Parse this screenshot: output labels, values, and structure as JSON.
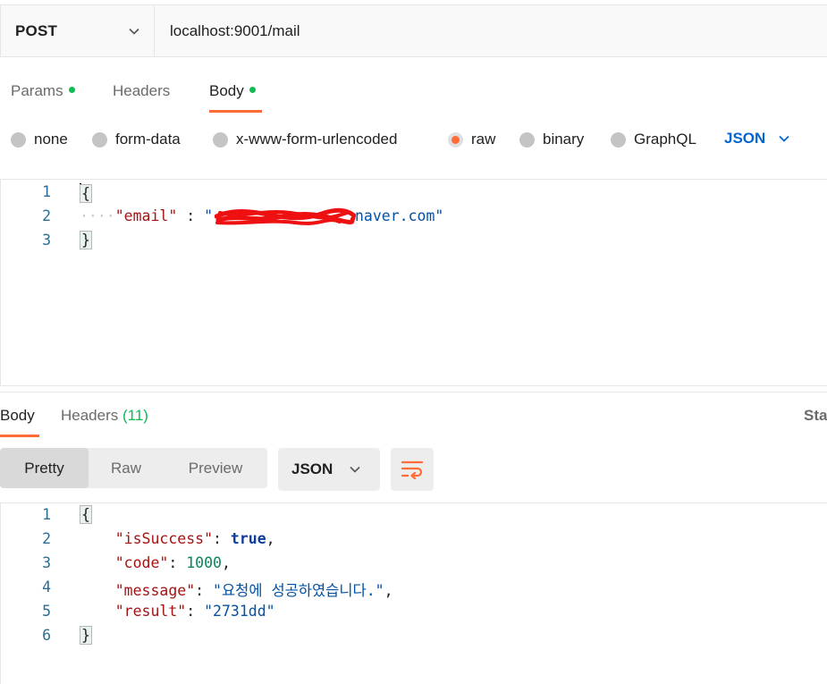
{
  "request": {
    "method": "POST",
    "url": "localhost:9001/mail",
    "tabs": [
      {
        "label": "Params",
        "has_dot": true
      },
      {
        "label": "Headers",
        "has_dot": false
      },
      {
        "label": "Body",
        "has_dot": true,
        "active": true
      }
    ],
    "body_types": [
      "none",
      "form-data",
      "x-www-form-urlencoded",
      "raw",
      "binary",
      "GraphQL"
    ],
    "selected_body_type": "raw",
    "language": "JSON",
    "editor": {
      "line_numbers": [
        "1",
        "2",
        "3"
      ],
      "open_brace": "{",
      "close_brace": "}",
      "indent_marker": "····",
      "key": "\"email\"",
      "separator": " : ",
      "value_visible": "naver.com\""
    }
  },
  "response": {
    "tabs": {
      "body": "Body",
      "headers": "Headers",
      "headers_count": "(11)"
    },
    "status_label": "Sta",
    "view_modes": [
      "Pretty",
      "Raw",
      "Preview"
    ],
    "active_view": "Pretty",
    "format": "JSON",
    "editor": {
      "line_numbers": [
        "1",
        "2",
        "3",
        "4",
        "5",
        "6"
      ],
      "open_brace": "{",
      "close_brace": "}",
      "fields": [
        {
          "key": "\"isSuccess\"",
          "value": "true",
          "type": "bool",
          "comma": ","
        },
        {
          "key": "\"code\"",
          "value": "1000",
          "type": "num",
          "comma": ","
        },
        {
          "key": "\"message\"",
          "value": "\"요청에 성공하였습니다.\"",
          "type": "str",
          "comma": ","
        },
        {
          "key": "\"result\"",
          "value": "\"2731dd\"",
          "type": "str",
          "comma": ""
        }
      ]
    }
  },
  "colors": {
    "accent": "#ff6c37",
    "success_dot": "#0cbb52",
    "link_blue": "#0265d2"
  },
  "icons": [
    "chevron-down-icon",
    "wrap-lines-icon",
    "redaction-scribble"
  ]
}
